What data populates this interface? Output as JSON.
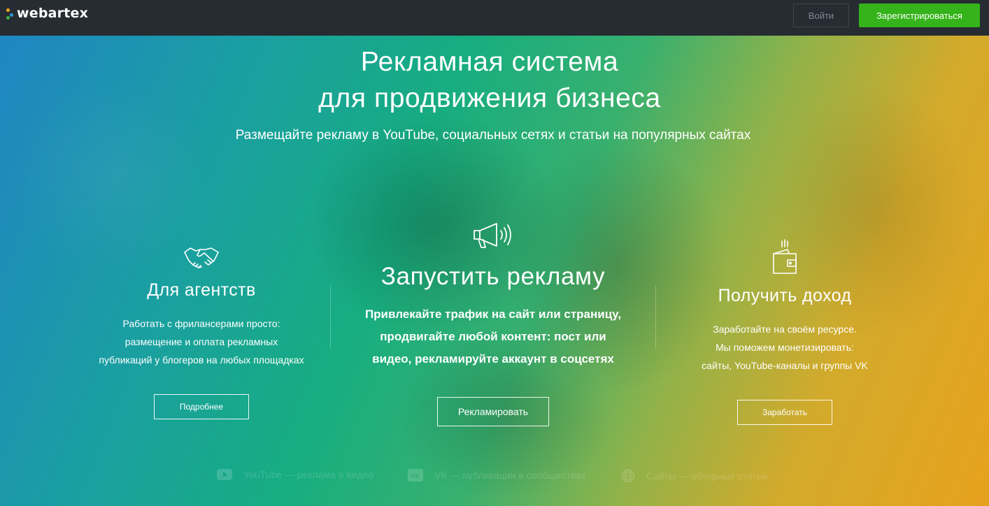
{
  "header": {
    "logo_text": "webartex",
    "login_label": "Войти",
    "register_label": "Зарегистрироваться",
    "colors": {
      "bar": "#262c31",
      "register": "#35b31a"
    }
  },
  "hero": {
    "title_line1": "Рекламная система",
    "title_line2": "для продвижения бизнеса",
    "subtitle": "Размещайте рекламу в YouTube, социальных сетях и статьи на популярных сайтах"
  },
  "columns": {
    "agencies": {
      "icon": "handshake-icon",
      "heading": "Для агентств",
      "line1": "Работать с фрилансерами просто:",
      "line2": "размещение и оплата рекламных",
      "line3": "публикаций у блогеров на любых площадках",
      "button": "Подробнее"
    },
    "launch": {
      "icon": "megaphone-icon",
      "heading": "Запустить рекламу",
      "line1": "Привлекайте трафик на сайт или страницу,",
      "line2_pre": "продвигайте ",
      "line2_bold": "любой контент",
      "line2_post": ": пост или",
      "line3": "видео, рекламируйте аккаунт в соцсетях",
      "button": "Рекламировать"
    },
    "income": {
      "icon": "wallet-icon",
      "heading": "Получить доход",
      "line1": "Заработайте на своём ресурсе.",
      "line2": "Мы поможем монетизировать:",
      "line3": "сайты, YouTube-каналы и группы VK",
      "button": "Заработать"
    }
  },
  "bottom": {
    "youtube": "YouTube — реклама в видео",
    "vk": "VK — публикации в сообществах",
    "sites": "Сайты — обзорные статьи"
  }
}
